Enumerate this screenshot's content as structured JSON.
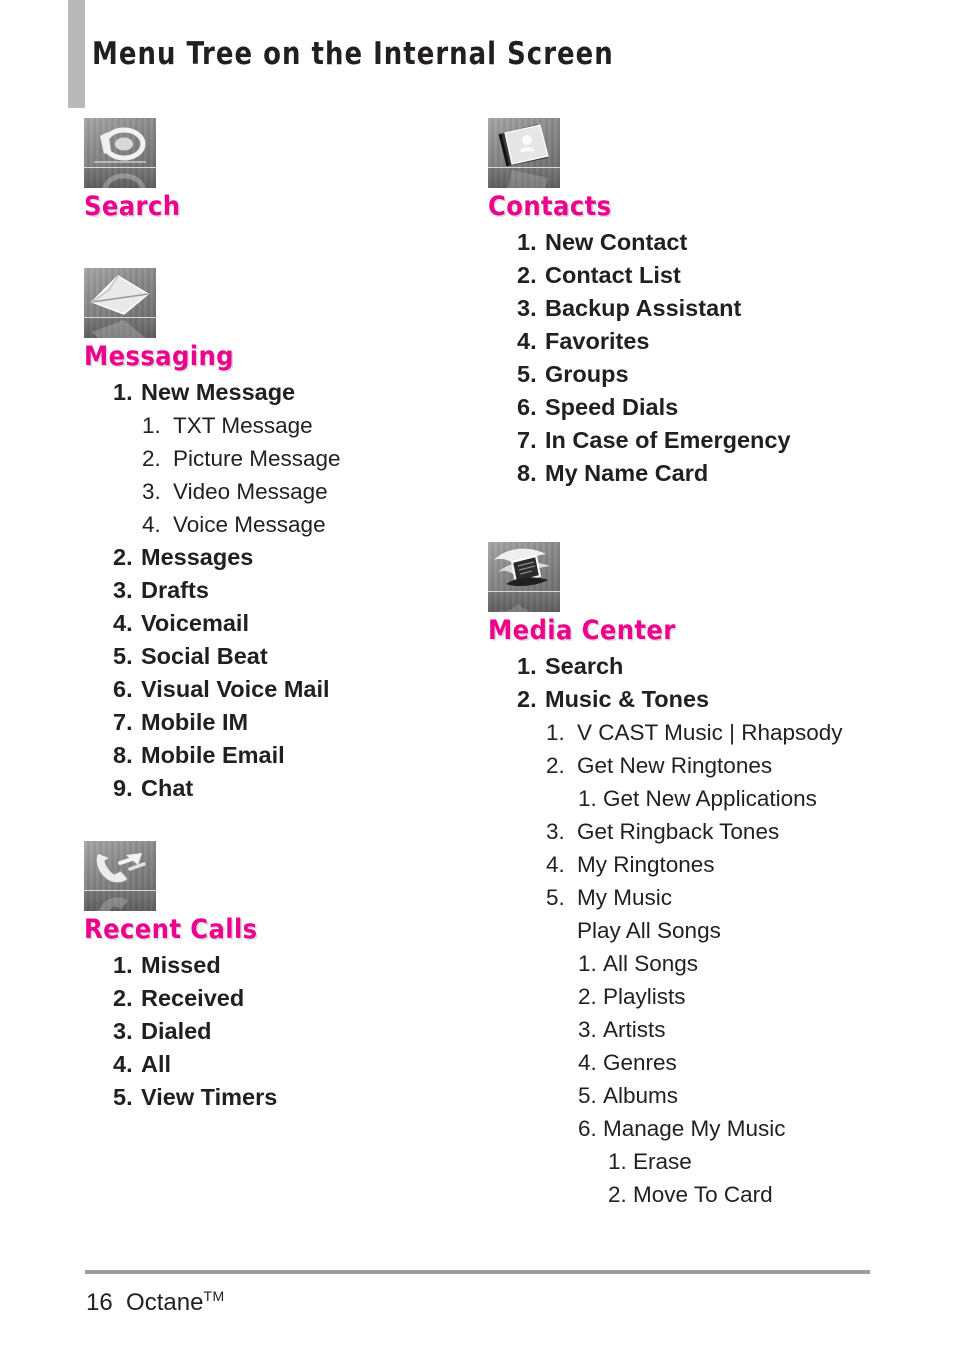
{
  "page": {
    "title": "Menu Tree on the Internal Screen",
    "accent_color": "#ec008c",
    "rule_color": "#9e9e9e",
    "title_bar_color": "#b9b9b9",
    "footer": {
      "page_number": "16",
      "product": "Octane",
      "trademark": "TM"
    }
  },
  "columns": {
    "left": [
      {
        "icon": "magnifier-icon",
        "title": "Search",
        "items": []
      },
      {
        "icon": "envelope-icon",
        "title": "Messaging",
        "items": [
          {
            "level": 1,
            "num": "1.",
            "label": "New Message"
          },
          {
            "level": 2,
            "num": "1.",
            "label": "TXT Message"
          },
          {
            "level": 2,
            "num": "2.",
            "label": "Picture Message"
          },
          {
            "level": 2,
            "num": "3.",
            "label": "Video Message"
          },
          {
            "level": 2,
            "num": "4.",
            "label": "Voice Message"
          },
          {
            "level": 1,
            "num": "2.",
            "label": "Messages"
          },
          {
            "level": 1,
            "num": "3.",
            "label": "Drafts"
          },
          {
            "level": 1,
            "num": "4.",
            "label": "Voicemail"
          },
          {
            "level": 1,
            "num": "5.",
            "label": "Social Beat"
          },
          {
            "level": 1,
            "num": "6.",
            "label": "Visual Voice Mail"
          },
          {
            "level": 1,
            "num": "7.",
            "label": "Mobile IM"
          },
          {
            "level": 1,
            "num": "8.",
            "label": "Mobile Email"
          },
          {
            "level": 1,
            "num": "9.",
            "label": "Chat"
          }
        ]
      },
      {
        "icon": "phone-recent-calls-icon",
        "title": "Recent Calls",
        "items": [
          {
            "level": 1,
            "num": "1.",
            "label": "Missed"
          },
          {
            "level": 1,
            "num": "2.",
            "label": "Received"
          },
          {
            "level": 1,
            "num": "3.",
            "label": "Dialed"
          },
          {
            "level": 1,
            "num": "4.",
            "label": "All"
          },
          {
            "level": 1,
            "num": "5.",
            "label": "View Timers"
          }
        ]
      }
    ],
    "right": [
      {
        "icon": "address-book-icon",
        "title": "Contacts",
        "items": [
          {
            "level": 1,
            "num": "1.",
            "label": "New Contact"
          },
          {
            "level": 1,
            "num": "2.",
            "label": "Contact List"
          },
          {
            "level": 1,
            "num": "3.",
            "label": "Backup Assistant"
          },
          {
            "level": 1,
            "num": "4.",
            "label": "Favorites"
          },
          {
            "level": 1,
            "num": "5.",
            "label": "Groups"
          },
          {
            "level": 1,
            "num": "6.",
            "label": "Speed Dials"
          },
          {
            "level": 1,
            "num": "7.",
            "label": "In Case of Emergency"
          },
          {
            "level": 1,
            "num": "8.",
            "label": "My Name Card"
          }
        ]
      },
      {
        "icon": "media-center-icon",
        "title": "Media Center",
        "items": [
          {
            "level": 1,
            "num": "1.",
            "label": "Search"
          },
          {
            "level": 1,
            "num": "2.",
            "label": "Music & Tones"
          },
          {
            "level": 2,
            "num": "1.",
            "label": "V CAST Music | Rhapsody"
          },
          {
            "level": 2,
            "num": "2.",
            "label": "Get New Ringtones"
          },
          {
            "level": 3,
            "num": "1.",
            "label": "Get New Applications"
          },
          {
            "level": 2,
            "num": "3.",
            "label": "Get Ringback Tones"
          },
          {
            "level": 2,
            "num": "4.",
            "label": "My Ringtones"
          },
          {
            "level": 2,
            "num": "5.",
            "label": "My Music"
          },
          {
            "level": 2,
            "num": "",
            "label": "Play All Songs"
          },
          {
            "level": 3,
            "num": "1.",
            "label": "All Songs"
          },
          {
            "level": 3,
            "num": "2.",
            "label": "Playlists"
          },
          {
            "level": 3,
            "num": "3.",
            "label": "Artists"
          },
          {
            "level": 3,
            "num": "4.",
            "label": "Genres"
          },
          {
            "level": 3,
            "num": "5.",
            "label": "Albums"
          },
          {
            "level": 3,
            "num": "6.",
            "label": "Manage My Music"
          },
          {
            "level": 4,
            "num": "1.",
            "label": "Erase"
          },
          {
            "level": 4,
            "num": "2.",
            "label": "Move To Card"
          }
        ]
      }
    ]
  }
}
